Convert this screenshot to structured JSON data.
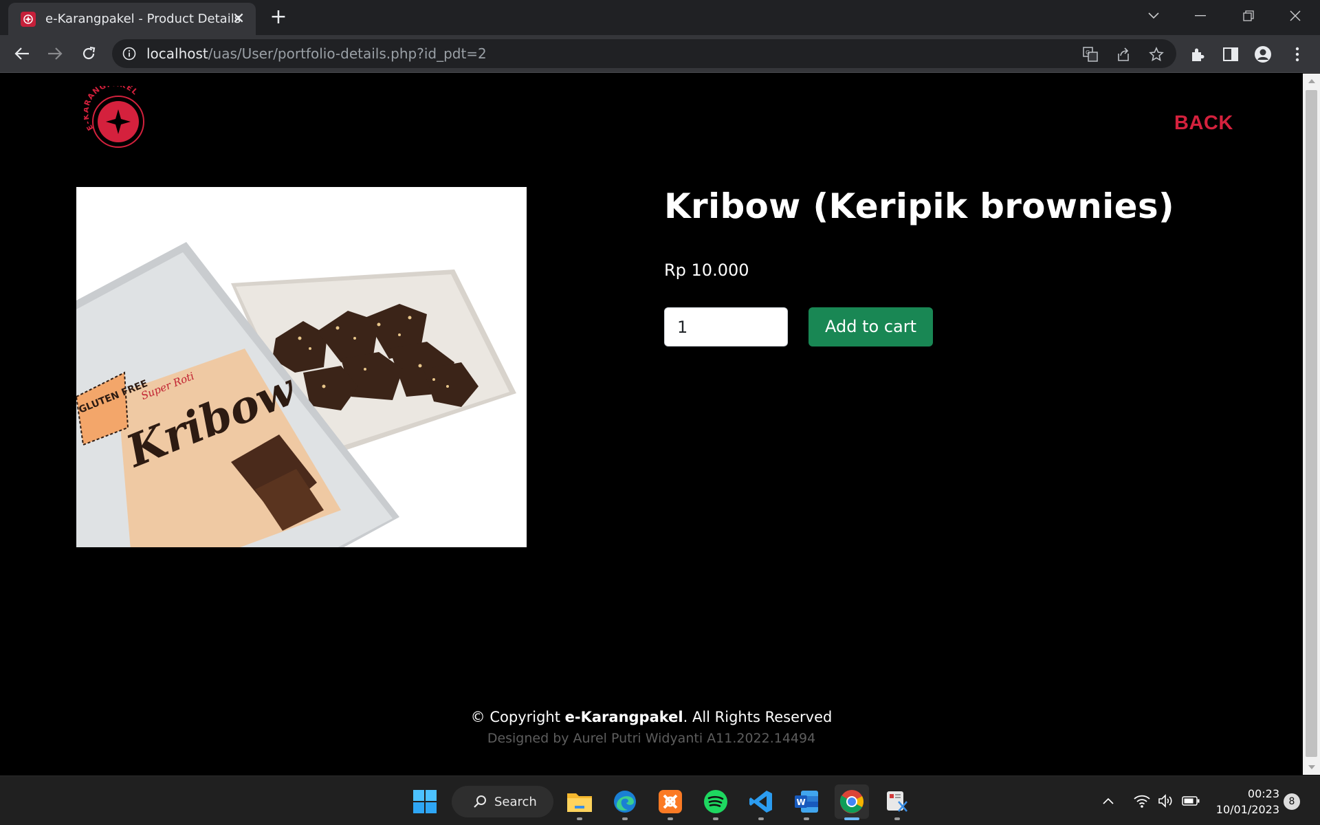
{
  "browser": {
    "tab_title": "e-Karangpakel - Product Details",
    "tab_close": "✕",
    "new_tab": "+",
    "url_host": "localhost",
    "url_path": "/uas/User/portfolio-details.php?id_pdt=2"
  },
  "page": {
    "logo_text": "E-KARANGPAKEL",
    "back_label": "BACK",
    "product": {
      "title": "Kribow (Keripik brownies)",
      "price": "Rp 10.000",
      "quantity": "1",
      "add_to_cart_label": "Add to cart",
      "image_texts": {
        "brand": "Super Roti",
        "name": "Kribow",
        "badge": "GLUTEN FREE"
      }
    },
    "footer": {
      "copyright_prefix": "© Copyright ",
      "copyright_brand": "e-Karangpakel",
      "copyright_suffix": ". All Rights Reserved",
      "designed_by": "Designed by Aurel Putri Widyanti A11.2022.14494"
    }
  },
  "taskbar": {
    "search_label": "Search",
    "time": "00:23",
    "date": "10/01/2023",
    "notification_count": "8"
  },
  "colors": {
    "accent_red": "#d4213d",
    "cart_green": "#198754",
    "page_bg": "#000000"
  }
}
